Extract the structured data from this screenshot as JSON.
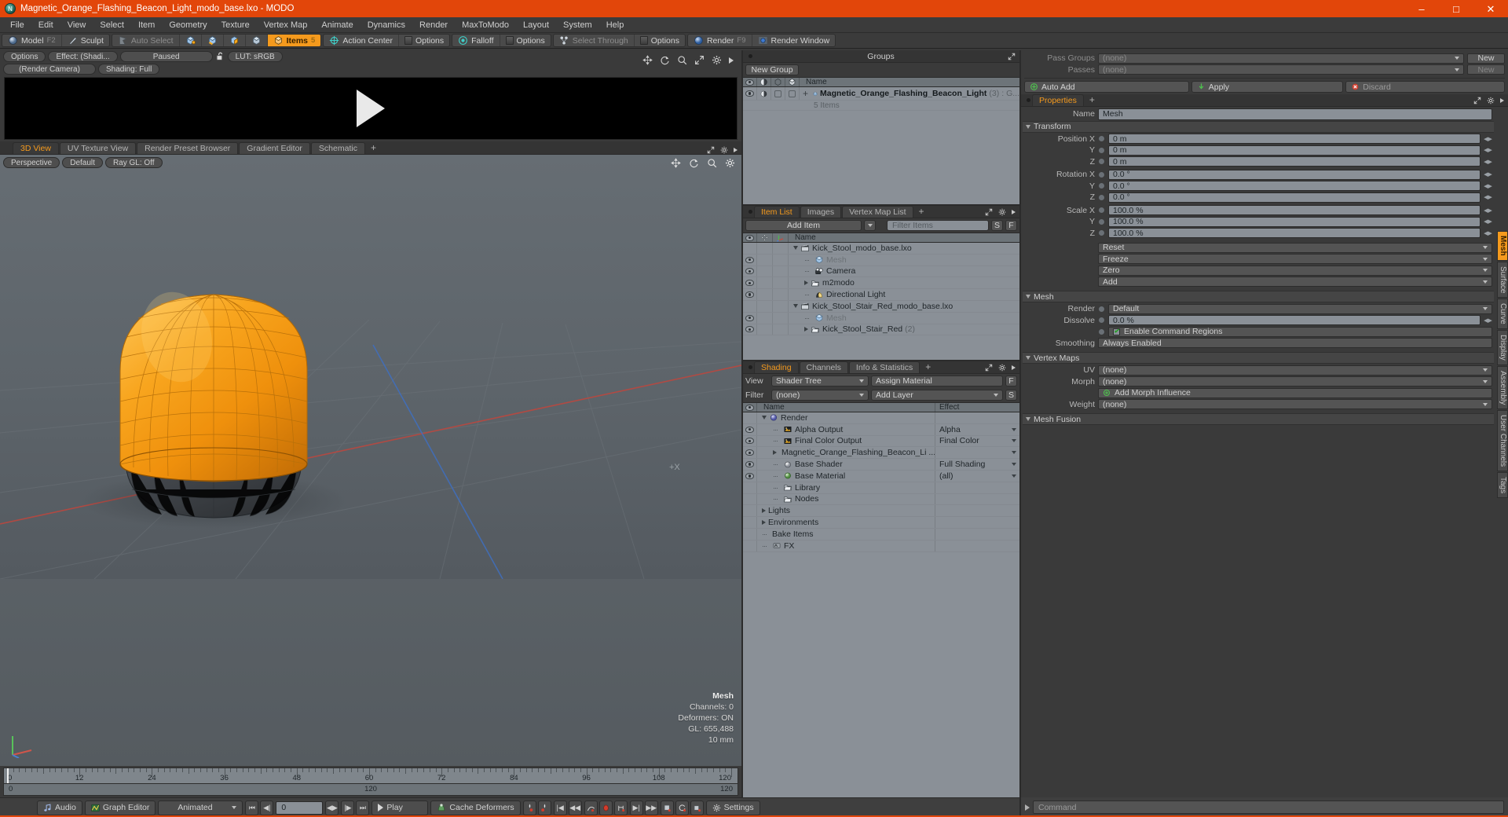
{
  "titlebar": {
    "title": "Magnetic_Orange_Flashing_Beacon_Light_modo_base.lxo - MODO",
    "minimize": "–",
    "maximize": "□",
    "close": "✕"
  },
  "menubar": {
    "items": [
      "File",
      "Edit",
      "View",
      "Select",
      "Item",
      "Geometry",
      "Texture",
      "Vertex Map",
      "Animate",
      "Dynamics",
      "Render",
      "MaxToModo",
      "Layout",
      "System",
      "Help"
    ]
  },
  "modebar": {
    "model": "Model",
    "model_hotkey": "F2",
    "sculpt": "Sculpt",
    "auto_select": "Auto Select",
    "items": "Items",
    "items_hotkey": "5",
    "action_center": "Action Center",
    "options1": "Options",
    "falloff": "Falloff",
    "options2": "Options",
    "select_through": "Select Through",
    "options3": "Options",
    "render": "Render",
    "render_hotkey": "F9",
    "render_window": "Render Window"
  },
  "preview": {
    "options": "Options",
    "effect": "Effect: (Shadi...",
    "paused": "Paused",
    "lut": "LUT: sRGB",
    "camera": "(Render Camera)",
    "shading": "Shading: Full"
  },
  "viewtabs": {
    "tabs": [
      "3D View",
      "UV Texture View",
      "Render Preset Browser",
      "Gradient Editor",
      "Schematic"
    ],
    "active": "3D View",
    "plus": "+"
  },
  "viewport": {
    "perspective": "Perspective",
    "default": "Default",
    "raygl": "Ray GL: Off",
    "stats": {
      "mesh": "Mesh",
      "channels": "Channels: 0",
      "deformers": "Deformers: ON",
      "gl": "GL: 655,488",
      "units": "10 mm"
    },
    "center_mark": "+X"
  },
  "timeline": {
    "labels": [
      "0",
      "12",
      "24",
      "36",
      "48",
      "60",
      "72",
      "84",
      "96",
      "108",
      "120"
    ],
    "range_start": "0",
    "range_mid": "120",
    "range_end": "120",
    "playhead_frame": 0
  },
  "groups_panel": {
    "title": "Groups",
    "new_group": "New Group",
    "columns": [
      "eye",
      "shade",
      "poly",
      "mesh",
      "Name"
    ],
    "name_header": "Name",
    "rows": [
      {
        "name": "Magnetic_Orange_Flashing_Beacon_Light",
        "count": "(3)",
        "suffix": ": G...",
        "sub": "5 Items"
      }
    ]
  },
  "item_list": {
    "tabs": [
      "Item List",
      "Images",
      "Vertex Map List"
    ],
    "active": "Item List",
    "plus": "+",
    "add_item": "Add Item",
    "filter_placeholder": "Filter Items",
    "filter_s": "S",
    "filter_f": "F",
    "name_header": "Name",
    "rows": [
      {
        "name": "Kick_Stool_modo_base.lxo",
        "icon": "scene-icon",
        "indent": 0,
        "expander": "down",
        "eye": false,
        "dim": false,
        "count": ""
      },
      {
        "name": "Mesh",
        "icon": "mesh-icon",
        "indent": 1,
        "expander": "leaf",
        "eye": true,
        "dim": true,
        "count": ""
      },
      {
        "name": "Camera",
        "icon": "camera-icon",
        "indent": 1,
        "expander": "leaf",
        "eye": true,
        "dim": false,
        "count": ""
      },
      {
        "name": "m2modo",
        "icon": "folder-icon",
        "indent": 1,
        "expander": "right",
        "eye": true,
        "dim": false,
        "count": ""
      },
      {
        "name": "Directional Light",
        "icon": "light-icon",
        "indent": 1,
        "expander": "leaf",
        "eye": true,
        "dim": false,
        "count": ""
      },
      {
        "name": "Kick_Stool_Stair_Red_modo_base.lxo",
        "icon": "scene-icon",
        "indent": 0,
        "expander": "down",
        "eye": false,
        "dim": false,
        "count": ""
      },
      {
        "name": "Mesh",
        "icon": "mesh-icon",
        "indent": 1,
        "expander": "leaf",
        "eye": true,
        "dim": true,
        "count": ""
      },
      {
        "name": "Kick_Stool_Stair_Red",
        "icon": "folder-icon",
        "indent": 1,
        "expander": "right",
        "eye": true,
        "dim": false,
        "count": "(2)"
      }
    ]
  },
  "shading_panel": {
    "tabs": [
      "Shading",
      "Channels",
      "Info & Statistics"
    ],
    "active": "Shading",
    "plus": "+",
    "view_label": "View",
    "view_value": "Shader Tree",
    "assign_material": "Assign Material",
    "assign_f": "F",
    "filter_label": "Filter",
    "filter_value": "(none)",
    "add_layer": "Add Layer",
    "add_layer_s": "S",
    "name_header": "Name",
    "effect_header": "Effect",
    "rows": [
      {
        "name": "Render",
        "effect": "",
        "icon": "render-globe-icon",
        "indent": 0,
        "expander": "down",
        "eye": false,
        "dropdown": false
      },
      {
        "name": "Alpha Output",
        "effect": "Alpha",
        "icon": "output-icon",
        "indent": 1,
        "expander": "leaf",
        "eye": true,
        "dropdown": true
      },
      {
        "name": "Final Color Output",
        "effect": "Final Color",
        "icon": "output-icon",
        "indent": 1,
        "expander": "leaf",
        "eye": true,
        "dropdown": true
      },
      {
        "name": "Magnetic_Orange_Flashing_Beacon_Li ...",
        "effect": "",
        "icon": "material-red-icon",
        "indent": 1,
        "expander": "right",
        "eye": true,
        "dropdown": true
      },
      {
        "name": "Base Shader",
        "effect": "Full Shading",
        "icon": "shader-icon",
        "indent": 1,
        "expander": "leaf",
        "eye": true,
        "dropdown": true
      },
      {
        "name": "Base Material",
        "effect": "(all)",
        "icon": "material-green-icon",
        "indent": 1,
        "expander": "leaf",
        "eye": true,
        "dropdown": true
      },
      {
        "name": "Library",
        "effect": "",
        "icon": "folder-icon",
        "indent": 1,
        "expander": "leaf",
        "eye": false,
        "dropdown": false
      },
      {
        "name": "Nodes",
        "effect": "",
        "icon": "folder-icon",
        "indent": 1,
        "expander": "leaf",
        "eye": false,
        "dropdown": false
      },
      {
        "name": "Lights",
        "effect": "",
        "icon": "none",
        "indent": 0,
        "expander": "right",
        "eye": false,
        "dropdown": false
      },
      {
        "name": "Environments",
        "effect": "",
        "icon": "none",
        "indent": 0,
        "expander": "right",
        "eye": false,
        "dropdown": false
      },
      {
        "name": "Bake Items",
        "effect": "",
        "icon": "none",
        "indent": 0,
        "expander": "leaf",
        "eye": false,
        "dropdown": false
      },
      {
        "name": "FX",
        "effect": "",
        "icon": "fx-icon",
        "indent": 0,
        "expander": "leaf",
        "eye": false,
        "dropdown": false
      }
    ]
  },
  "properties": {
    "pass_groups_label": "Pass Groups",
    "pass_groups_value": "(none)",
    "pass_groups_new": "New",
    "passes_label": "Passes",
    "passes_value": "(none)",
    "passes_new": "New",
    "auto_add": "Auto Add",
    "apply": "Apply",
    "discard": "Discard",
    "tab": "Properties",
    "tab_plus": "+",
    "name_label": "Name",
    "name_value": "Mesh",
    "transform_header": "Transform",
    "position_label": "Position X",
    "position": [
      "0 m",
      "0 m",
      "0 m"
    ],
    "rotation_label": "Rotation X",
    "rotation": [
      "0.0 °",
      "0.0 °",
      "0.0 °"
    ],
    "scale_label": "Scale X",
    "scale": [
      "100.0 %",
      "100.0 %",
      "100.0 %"
    ],
    "axis_y": "Y",
    "axis_z": "Z",
    "reset": "Reset",
    "freeze": "Freeze",
    "zero": "Zero",
    "add": "Add",
    "mesh_header": "Mesh",
    "render_label": "Render",
    "render_value": "Default",
    "dissolve_label": "Dissolve",
    "dissolve_value": "0.0 %",
    "enable_command_regions": "Enable Command Regions",
    "smoothing_label": "Smoothing",
    "smoothing_value": "Always Enabled",
    "vertex_maps_header": "Vertex Maps",
    "uv_label": "UV",
    "uv_value": "(none)",
    "morph_label": "Morph",
    "morph_value": "(none)",
    "add_morph_influence": "Add Morph Influence",
    "weight_label": "Weight",
    "weight_value": "(none)",
    "mesh_fusion_header": "Mesh Fusion",
    "vtabs": [
      "Mesh",
      "Surface",
      "Curve",
      "Display",
      "Assembly",
      "User Channels",
      "Tags"
    ],
    "vtab_active": "Mesh"
  },
  "bottombar": {
    "audio": "Audio",
    "graph_editor": "Graph Editor",
    "animated": "Animated",
    "frame_value": "0",
    "play": "Play",
    "cache_deformers": "Cache Deformers",
    "settings": "Settings",
    "command_placeholder": "Command"
  },
  "colors": {
    "accent": "#e2460a",
    "highlight": "#f59a1d",
    "beacon_orange": "#f0960f",
    "beacon_base": "#3f4246",
    "panel_bg": "#3a3a3a",
    "tree_bg": "#8a9097"
  }
}
